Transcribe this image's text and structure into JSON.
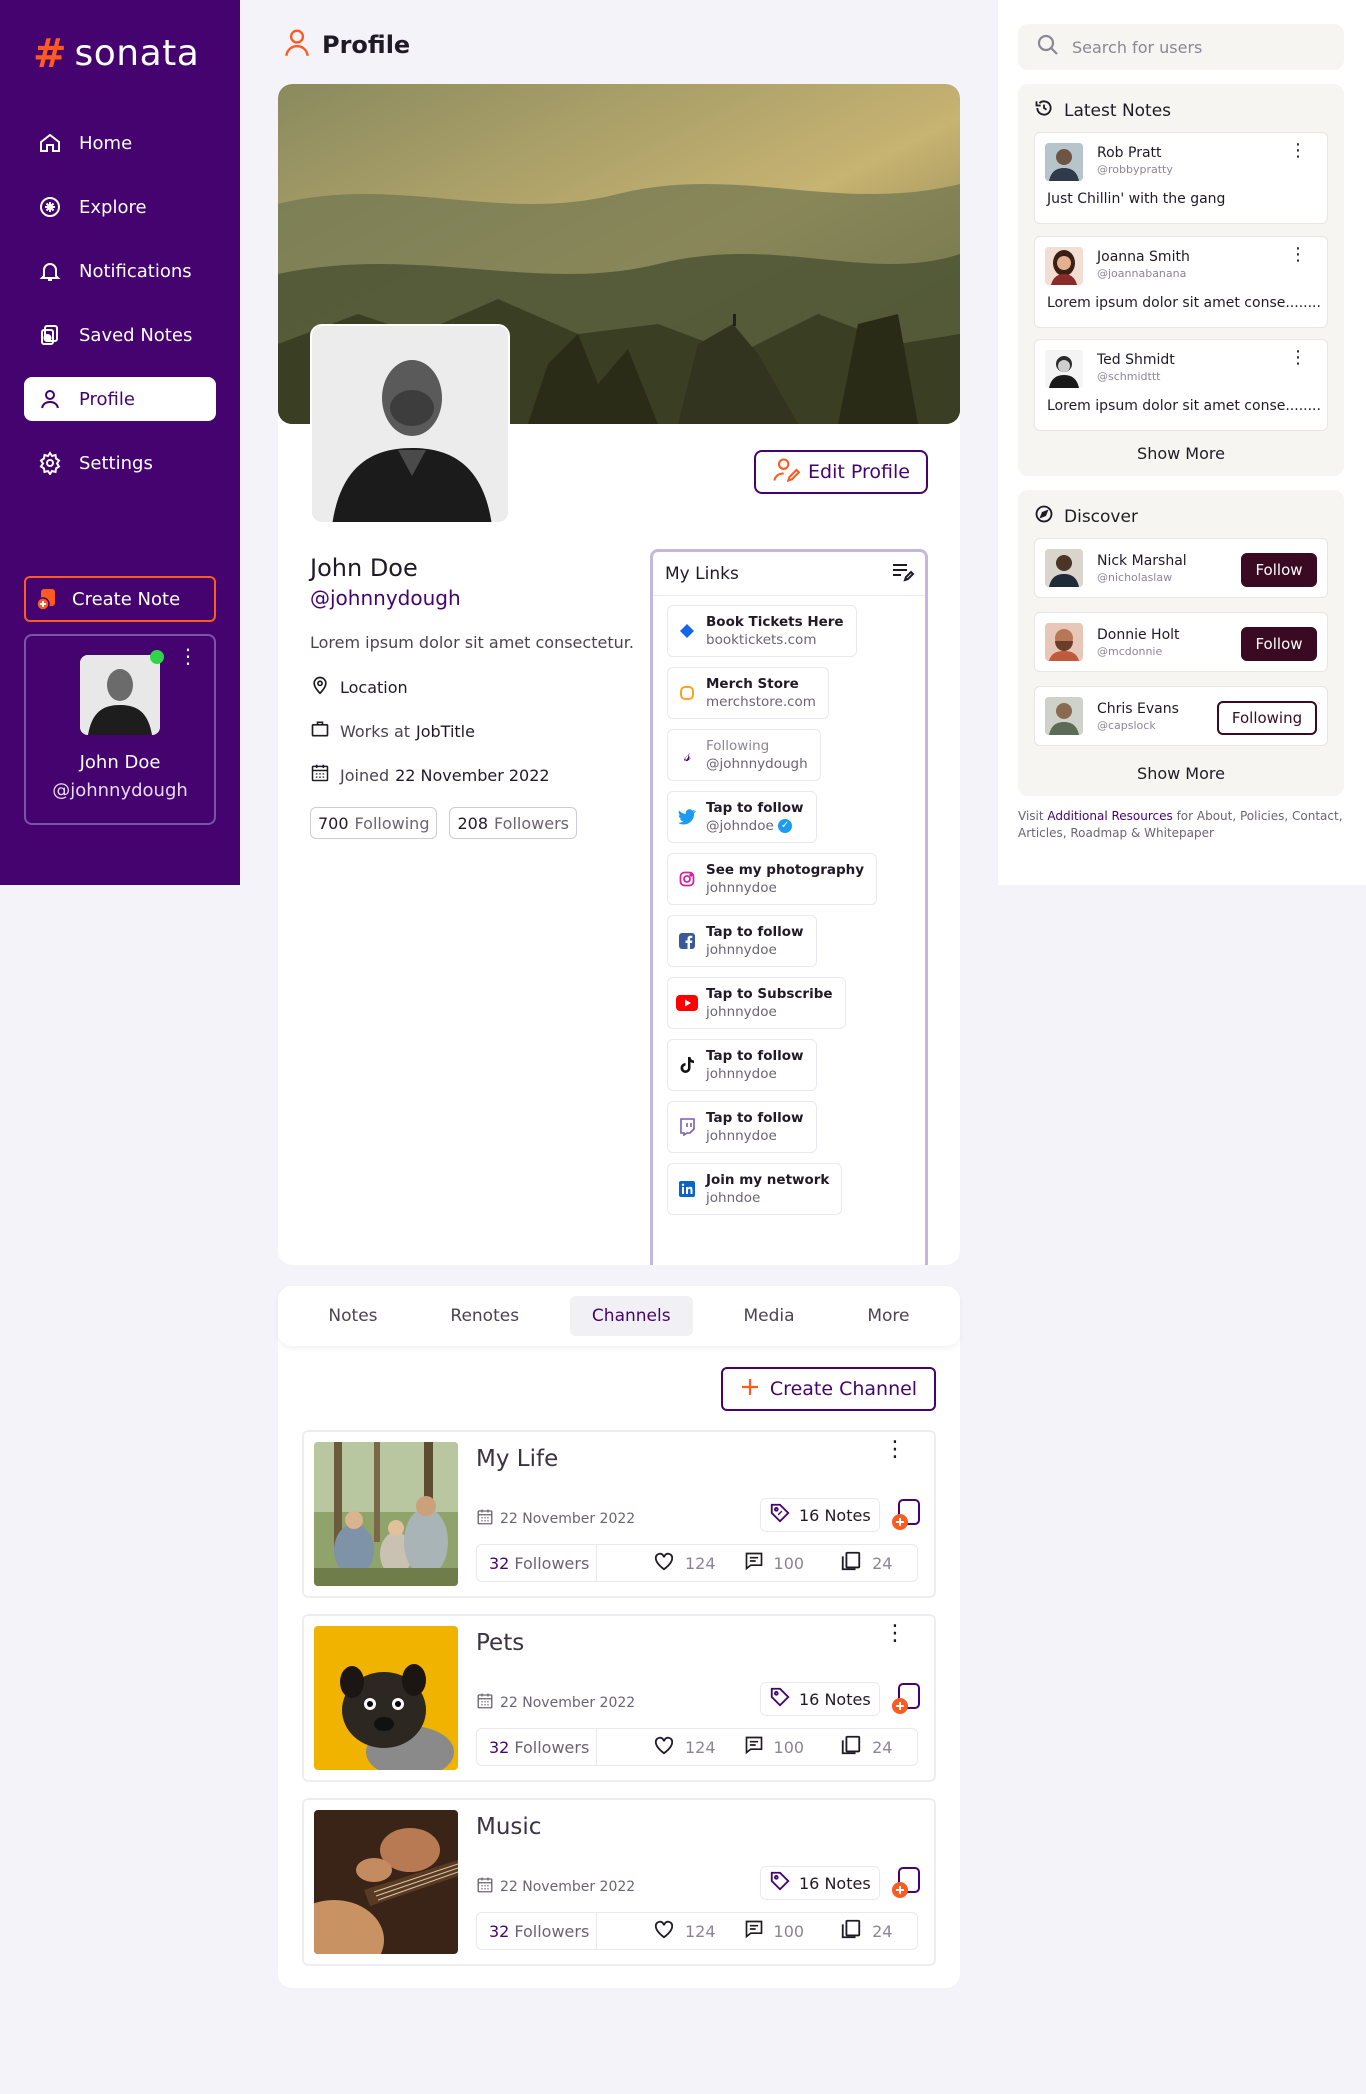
{
  "brand": {
    "logo_mark": "#",
    "logo_text": "sonata"
  },
  "sidebar": {
    "items": [
      {
        "label": "Home",
        "icon": "home-icon"
      },
      {
        "label": "Explore",
        "icon": "explore-icon"
      },
      {
        "label": "Notifications",
        "icon": "bell-icon"
      },
      {
        "label": "Saved Notes",
        "icon": "saved-notes-icon"
      },
      {
        "label": "Profile",
        "icon": "profile-icon",
        "active": true
      },
      {
        "label": "Settings",
        "icon": "settings-icon"
      }
    ],
    "create_note_label": "Create Note",
    "user_card": {
      "name": "John Doe",
      "handle": "@johnnydough"
    }
  },
  "header": {
    "title": "Profile"
  },
  "profile": {
    "name": "John Doe",
    "handle": "@johnnydough",
    "bio": "Lorem ipsum dolor sit amet consectetur.",
    "location": "Location",
    "works_prefix": "Works at",
    "job_title": "JobTitle",
    "joined_prefix": "Joined",
    "joined_date": "22 November 2022",
    "following_count": "700",
    "following_label": "Following",
    "followers_count": "208",
    "followers_label": "Followers",
    "edit_label": "Edit Profile"
  },
  "links": {
    "title": "My Links",
    "items": [
      {
        "label": "Book Tickets Here",
        "sub": "booktickets.com",
        "icon": "ticket-icon"
      },
      {
        "label": "Merch Store",
        "sub": "merchstore.com",
        "icon": "merch-icon"
      },
      {
        "label": "Following",
        "sub": "@johnnydough",
        "icon": "sonata-icon"
      },
      {
        "label": "Tap to follow",
        "sub": "@johndoe",
        "icon": "twitter-icon"
      },
      {
        "label": "See my photography",
        "sub": "johnnydoe",
        "icon": "instagram-icon"
      },
      {
        "label": "Tap to follow",
        "sub": "johnnydoe",
        "icon": "facebook-icon"
      },
      {
        "label": "Tap to Subscribe",
        "sub": "johnnydoe",
        "icon": "youtube-icon"
      },
      {
        "label": "Tap to follow",
        "sub": "johnnydoe",
        "icon": "tiktok-icon"
      },
      {
        "label": "Tap to follow",
        "sub": "johnnydoe",
        "icon": "twitch-icon"
      },
      {
        "label": "Join my network",
        "sub": "johndoe",
        "icon": "linkedin-icon"
      }
    ]
  },
  "tabs": [
    {
      "label": "Notes"
    },
    {
      "label": "Renotes"
    },
    {
      "label": "Channels",
      "active": true
    },
    {
      "label": "Media"
    },
    {
      "label": "More"
    }
  ],
  "create_channel_label": "Create Channel",
  "channels": [
    {
      "title": "My Life",
      "date": "22 November 2022",
      "notes": "16 Notes",
      "followers_count": "32",
      "followers_label": "Followers",
      "likes": "124",
      "comments": "100",
      "copies": "24"
    },
    {
      "title": "Pets",
      "date": "22 November 2022",
      "notes": "16 Notes",
      "followers_count": "32",
      "followers_label": "Followers",
      "likes": "124",
      "comments": "100",
      "copies": "24"
    },
    {
      "title": "Music",
      "date": "22 November 2022",
      "notes": "16 Notes",
      "followers_count": "32",
      "followers_label": "Followers",
      "likes": "124",
      "comments": "100",
      "copies": "24"
    }
  ],
  "search": {
    "placeholder": "Search for users"
  },
  "latest_notes": {
    "title": "Latest Notes",
    "items": [
      {
        "name": "Rob Pratt",
        "handle": "@robbypratty",
        "text": "Just Chillin' with the gang"
      },
      {
        "name": "Joanna Smith",
        "handle": "@joannabanana",
        "text": "Lorem ipsum dolor sit amet conse........"
      },
      {
        "name": "Ted Shmidt",
        "handle": "@schmidttt",
        "text": "Lorem ipsum dolor sit amet conse........"
      }
    ],
    "show_more": "Show More"
  },
  "discover": {
    "title": "Discover",
    "items": [
      {
        "name": "Nick Marshal",
        "handle": "@nicholaslaw",
        "button": "Follow"
      },
      {
        "name": "Donnie Holt",
        "handle": "@mcdonnie",
        "button": "Follow"
      },
      {
        "name": "Chris Evans",
        "handle": "@capslock",
        "button": "Following"
      }
    ],
    "show_more": "Show More"
  },
  "footer": {
    "prefix": "Visit",
    "link": "Additional Resources",
    "suffix": "for About, Policies, Contact, Articles, Roadmap & Whitepaper"
  },
  "colors": {
    "brand_purple": "#44036f",
    "accent_orange": "#ff5a1f",
    "online_green": "#2fd44a"
  }
}
